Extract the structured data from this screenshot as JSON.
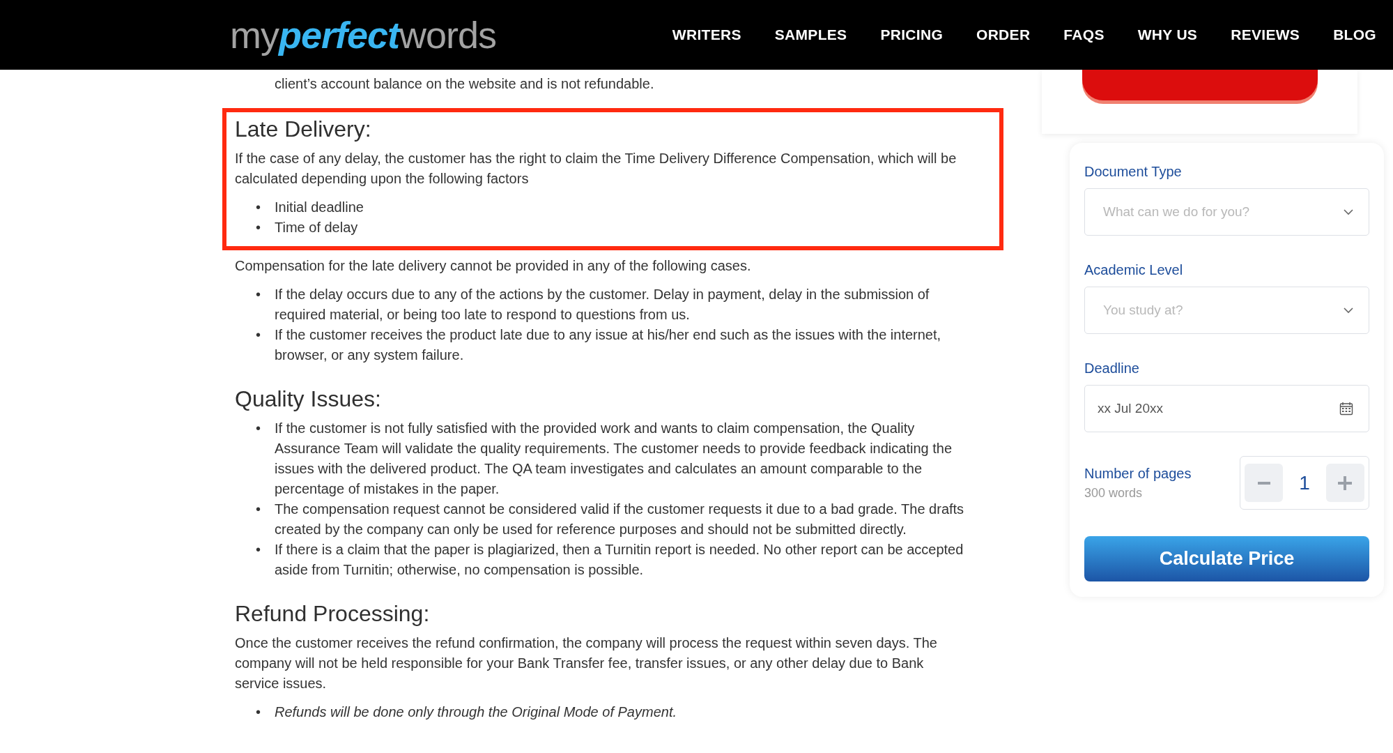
{
  "header": {
    "logo": [
      {
        "text": "my",
        "kind": "plain"
      },
      {
        "text": "perfect",
        "kind": "accent"
      },
      {
        "text": "words",
        "kind": "plain"
      }
    ],
    "nav": [
      "WRITERS",
      "SAMPLES",
      "PRICING",
      "ORDER",
      "FAQS",
      "WHY US",
      "REVIEWS",
      "BLOG"
    ]
  },
  "content": {
    "continued_text": "client’s account balance on the website and is not refundable.",
    "groups": [
      {
        "highlighted": true,
        "blocks": [
          {
            "kind": "heading",
            "text": "Late Delivery:"
          },
          {
            "kind": "paragraph",
            "text": "If the case of any delay, the customer has the right to claim the Time Delivery Difference Compensation, which will be calculated depending upon the following factors"
          },
          {
            "kind": "list",
            "italic": false,
            "marker": "•",
            "items": [
              "Initial deadline",
              "Time of delay"
            ]
          }
        ]
      },
      {
        "highlighted": false,
        "blocks": [
          {
            "kind": "paragraph",
            "text": "Compensation for the late delivery cannot be provided in any of the following cases."
          },
          {
            "kind": "list",
            "italic": false,
            "marker": "•",
            "items": [
              "If the delay occurs due to any of the actions by the customer. Delay in payment, delay in the submission of required material, or being too late to respond to questions from us.",
              "If the customer receives the product late due to any issue at his/her end such as the issues with the internet, browser, or any system failure."
            ]
          },
          {
            "kind": "heading",
            "text": "Quality Issues:"
          },
          {
            "kind": "list",
            "italic": false,
            "marker": "•",
            "items": [
              "If the customer is not fully satisfied with the provided work and wants to claim compensation, the Quality Assurance Team will validate the quality requirements. The customer needs to provide feedback indicating the issues with the delivered product. The QA team investigates and calculates an amount comparable to the percentage of mistakes in the paper.",
              "The compensation request cannot be considered valid if the customer requests it due to a bad grade. The drafts created by the company can only be used for reference purposes and should not be submitted directly.",
              "If there is a claim that the paper is plagiarized, then a Turnitin report is needed. No other report can be accepted aside from Turnitin; otherwise, no compensation is possible."
            ]
          },
          {
            "kind": "heading",
            "text": "Refund Processing:"
          },
          {
            "kind": "paragraph",
            "text": "Once the customer receives the refund confirmation, the company will process the request within seven days. The company will not be held responsible for your Bank Transfer fee, transfer issues, or any other delay due to Bank service issues."
          },
          {
            "kind": "list",
            "italic": true,
            "marker": "•",
            "items": [
              "Refunds will be done only through the Original Mode of Payment."
            ]
          }
        ]
      }
    ]
  },
  "sidebar": {
    "fields": [
      {
        "kind": "select",
        "label": "Document Type",
        "placeholder": "What can we do for you?"
      },
      {
        "kind": "select",
        "label": "Academic Level",
        "placeholder": "You study at?"
      },
      {
        "kind": "date",
        "label": "Deadline",
        "value": "xx Jul 20xx"
      }
    ],
    "pages": {
      "label": "Number of pages",
      "hint": "300 words",
      "value": "1"
    },
    "submit": "Calculate Price"
  }
}
